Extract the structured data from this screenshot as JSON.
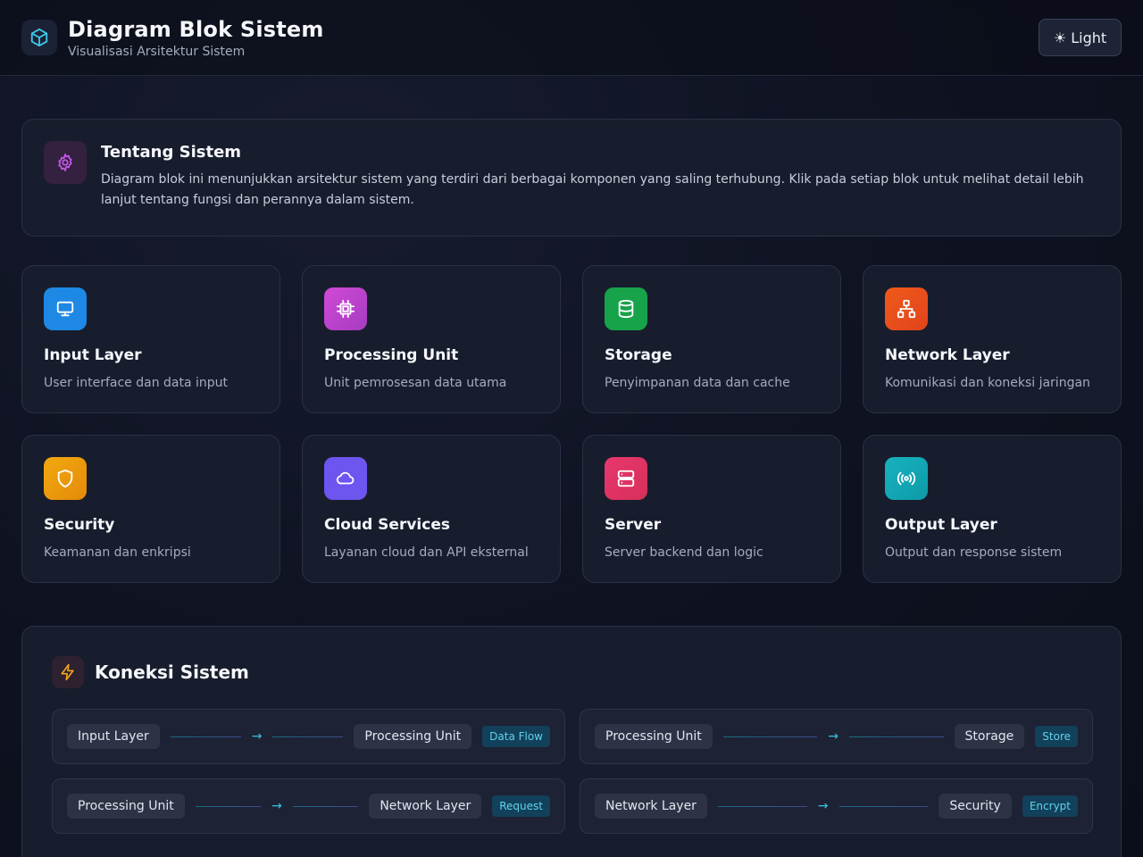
{
  "header": {
    "title": "Diagram Blok Sistem",
    "subtitle": "Visualisasi Arsitektur Sistem",
    "theme_button": "☀ Light",
    "logo_icon": "cube-icon"
  },
  "about": {
    "title": "Tentang Sistem",
    "description": "Diagram blok ini menunjukkan arsitektur sistem yang terdiri dari berbagai komponen yang saling terhubung. Klik pada setiap blok untuk melihat detail lebih lanjut tentang fungsi dan perannya dalam sistem.",
    "icon": "gear-icon"
  },
  "blocks": [
    {
      "title": "Input Layer",
      "desc": "User interface dan data input",
      "icon": "monitor-icon",
      "color": "#1e88e5"
    },
    {
      "title": "Processing Unit",
      "desc": "Unit pemrosesan data utama",
      "icon": "cpu-icon",
      "color": "#c044c8"
    },
    {
      "title": "Storage",
      "desc": "Penyimpanan data dan cache",
      "icon": "database-icon",
      "color": "#16a34a"
    },
    {
      "title": "Network Layer",
      "desc": "Komunikasi dan koneksi jaringan",
      "icon": "network-icon",
      "color": "#ea580c"
    },
    {
      "title": "Security",
      "desc": "Keamanan dan enkripsi",
      "icon": "shield-icon",
      "color": "#e8a20c"
    },
    {
      "title": "Cloud Services",
      "desc": "Layanan cloud dan API eksternal",
      "icon": "cloud-icon",
      "color": "#6d55f0"
    },
    {
      "title": "Server",
      "desc": "Server backend dan logic",
      "icon": "server-icon",
      "color": "#e2346a"
    },
    {
      "title": "Output Layer",
      "desc": "Output dan response sistem",
      "icon": "broadcast-icon",
      "color": "#14a8b8"
    }
  ],
  "connections": {
    "title": "Koneksi Sistem",
    "icon": "lightning-icon",
    "items": [
      {
        "from": "Input Layer",
        "to": "Processing Unit",
        "label": "Data Flow"
      },
      {
        "from": "Processing Unit",
        "to": "Storage",
        "label": "Store"
      },
      {
        "from": "Processing Unit",
        "to": "Network Layer",
        "label": "Request"
      },
      {
        "from": "Network Layer",
        "to": "Security",
        "label": "Encrypt"
      }
    ]
  }
}
